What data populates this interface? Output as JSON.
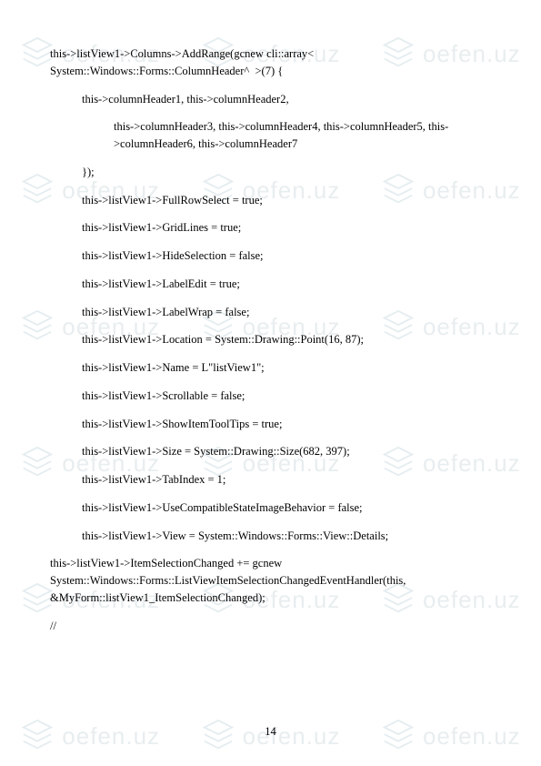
{
  "watermark": {
    "text": "oefen.uz",
    "icon_color": "#5a8a9e"
  },
  "code_lines": [
    {
      "text": "this->listView1->Columns->AddRange(gcnew cli::array< System::Windows::Forms::ColumnHeader^  >(7) {",
      "indent": 0
    },
    {
      "text": "this->columnHeader1, this->columnHeader2,",
      "indent": 1
    },
    {
      "text": "this->columnHeader3, this->columnHeader4, this->columnHeader5, this->columnHeader6, this->columnHeader7",
      "indent": 2
    },
    {
      "text": "});",
      "indent": 1
    },
    {
      "text": "this->listView1->FullRowSelect = true;",
      "indent": 1
    },
    {
      "text": "this->listView1->GridLines = true;",
      "indent": 1
    },
    {
      "text": "this->listView1->HideSelection = false;",
      "indent": 1
    },
    {
      "text": "this->listView1->LabelEdit = true;",
      "indent": 1
    },
    {
      "text": "this->listView1->LabelWrap = false;",
      "indent": 1
    },
    {
      "text": "this->listView1->Location = System::Drawing::Point(16, 87);",
      "indent": 1
    },
    {
      "text": "this->listView1->Name = L\"listView1\";",
      "indent": 1
    },
    {
      "text": "this->listView1->Scrollable = false;",
      "indent": 1
    },
    {
      "text": "this->listView1->ShowItemToolTips = true;",
      "indent": 1
    },
    {
      "text": "this->listView1->Size = System::Drawing::Size(682, 397);",
      "indent": 1
    },
    {
      "text": "this->listView1->TabIndex = 1;",
      "indent": 1
    },
    {
      "text": "this->listView1->UseCompatibleStateImageBehavior = false;",
      "indent": 1
    },
    {
      "text": "this->listView1->View = System::Windows::Forms::View::Details;",
      "indent": 1
    },
    {
      "text": "this->listView1->ItemSelectionChanged += gcnew System::Windows::Forms::ListViewItemSelectionChangedEventHandler(this, &MyForm::listView1_ItemSelectionChanged);",
      "indent": 0
    },
    {
      "text": "// ",
      "indent": 0
    }
  ],
  "page_number": "14"
}
